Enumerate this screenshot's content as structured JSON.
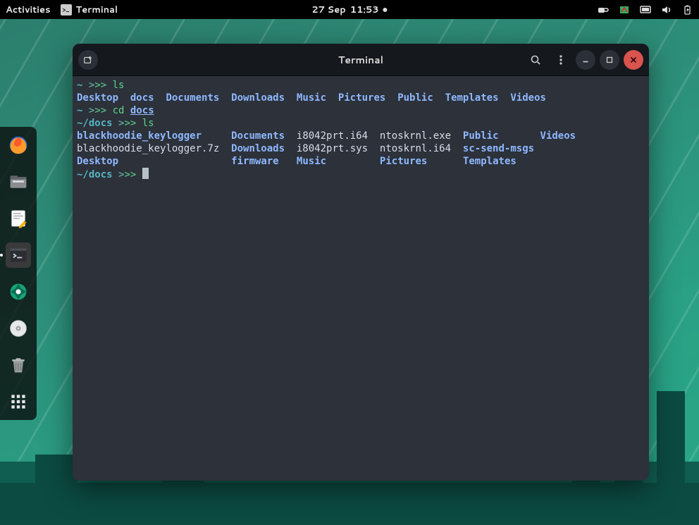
{
  "topbar": {
    "activities": "Activities",
    "app_label": "Terminal",
    "date": "27 Sep",
    "time": "11:53"
  },
  "dock": {
    "items": [
      {
        "name": "firefox"
      },
      {
        "name": "files"
      },
      {
        "name": "text-editor"
      },
      {
        "name": "terminal"
      },
      {
        "name": "screenshot"
      },
      {
        "name": "disc"
      },
      {
        "name": "trash"
      },
      {
        "name": "apps-grid"
      }
    ]
  },
  "window": {
    "title": "Terminal"
  },
  "terminal": {
    "lines": [
      {
        "prompt_path": "~",
        "cmd": "ls"
      },
      {
        "output": "Desktop  docs  Documents  Downloads  Music  Pictures  Public  Templates  Videos",
        "dir_all": true
      },
      {
        "prompt_path": "~",
        "cmd": "cd ",
        "arg": "docs",
        "arg_underline": true
      },
      {
        "prompt_path": "~/docs",
        "cmd": "ls"
      },
      {
        "output": "blackhoodie_keylogger     Documents  i8042prt.i64  ntoskrnl.exe  Public       Videos"
      },
      {
        "output": "blackhoodie_keylogger.7z  Downloads  i8042prt.sys  ntoskrnl.i64  sc-send-msgs"
      },
      {
        "output": "Desktop                   firmware   Music         Pictures      Templates"
      },
      {
        "prompt_path": "~/docs",
        "cmd": "",
        "cursor": true
      }
    ],
    "listing1_dirs": [
      "Desktop",
      "docs",
      "Documents",
      "Downloads",
      "Music",
      "Pictures",
      "Public",
      "Templates",
      "Videos"
    ],
    "listing2": [
      [
        "blackhoodie_keylogger",
        "Documents",
        "i8042prt.i64",
        "ntoskrnl.exe",
        "Public",
        "Videos"
      ],
      [
        "blackhoodie_keylogger.7z",
        "Downloads",
        "i8042prt.sys",
        "ntoskrnl.i64",
        "sc-send-msgs",
        ""
      ],
      [
        "Desktop",
        "firmware",
        "Music",
        "Pictures",
        "Templates",
        ""
      ]
    ],
    "listing2_dirs": [
      "blackhoodie_keylogger",
      "Documents",
      "Downloads",
      "firmware",
      "Music",
      "Pictures",
      "Public",
      "sc-send-msgs",
      "Templates",
      "Videos",
      "Desktop"
    ]
  },
  "colors": {
    "bg": "#2c313a",
    "prompt_path": "#56b6c2",
    "prompt_gt": "#6fbfb3",
    "cmd": "#5fd38d",
    "dir": "#8fb8ff",
    "text": "#b7c0c8",
    "close": "#d9534f"
  }
}
